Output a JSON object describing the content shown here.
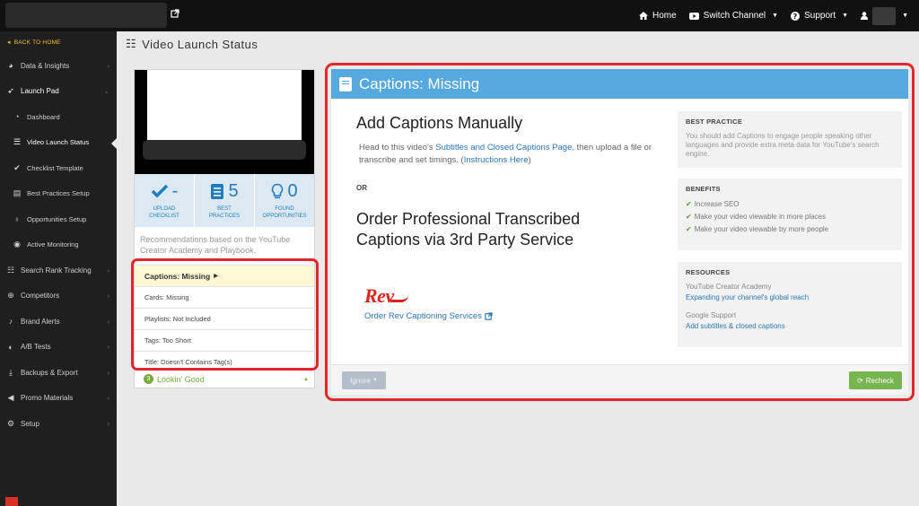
{
  "topbar": {
    "home": "Home",
    "switch_channel": "Switch Channel",
    "support": "Support"
  },
  "sidebar": {
    "back": "BACK TO HOME",
    "items": [
      {
        "label": "Data & Insights",
        "icon": "pie-chart-icon"
      },
      {
        "label": "Launch Pad",
        "icon": "rocket-icon"
      },
      {
        "label": "Dashboard",
        "icon": "dashboard-icon"
      },
      {
        "label": "Video Launch Status",
        "icon": "list-icon"
      },
      {
        "label": "Checklist Template",
        "icon": "check-icon"
      },
      {
        "label": "Best Practices Setup",
        "icon": "book-icon"
      },
      {
        "label": "Opportunities Setup",
        "icon": "lightbulb-icon"
      },
      {
        "label": "Active Monitoring",
        "icon": "eye-icon"
      },
      {
        "label": "Search Rank Tracking",
        "icon": "list-ol-icon"
      },
      {
        "label": "Competitors",
        "icon": "crosshair-icon"
      },
      {
        "label": "Brand Alerts",
        "icon": "bell-icon"
      },
      {
        "label": "A/B Tests",
        "icon": "contrast-icon"
      },
      {
        "label": "Backups & Export",
        "icon": "download-icon"
      },
      {
        "label": "Promo Materials",
        "icon": "megaphone-icon"
      },
      {
        "label": "Setup",
        "icon": "cogs-icon"
      }
    ]
  },
  "page": {
    "title": "Video Launch Status"
  },
  "stats": [
    {
      "value": "-",
      "label1": "UPLOAD",
      "label2": "CHECKLIST"
    },
    {
      "value": "5",
      "label1": "BEST",
      "label2": "PRACTICES"
    },
    {
      "value": "0",
      "label1": "FOUND",
      "label2": "OPPORTUNITIES"
    }
  ],
  "recommendations": "Recommendations based on the YouTube Creator Academy and Playbook.",
  "checklist": [
    "Captions: Missing",
    "Cards: Missing",
    "Playlists: Not Included",
    "Tags: Too Short",
    "Title: Doesn't Contains Tag(s)"
  ],
  "looking_good": {
    "count": "3",
    "label": "Lookin' Good"
  },
  "main": {
    "header": "Captions: Missing",
    "h_manual": "Add Captions Manually",
    "p_before": "Head to this video's ",
    "p_link1": "Subtitles and Closed Captions Page",
    "p_middle": ", then upload a file or transcribe and set timings. (",
    "p_link2": "Instructions Here",
    "p_after": ")",
    "or": "OR",
    "h_pro": "Order Professional Transcribed Captions via 3rd Party Service",
    "rev_logo": "Rev",
    "rev_link": "Order Rev Captioning Services",
    "best_practice_title": "BEST PRACTICE",
    "best_practice_text": "You should add Captions to engage people speaking other languages and provide extra meta data for YouTube's search engine.",
    "benefits_title": "BENEFITS",
    "benefits": [
      "Increase SEO",
      "Make your video viewable in more places",
      "Make your video viewable by more people"
    ],
    "resources_title": "RESOURCES",
    "resources": [
      {
        "source": "YouTube Creator Academy",
        "link": "Expanding your channel's global reach"
      },
      {
        "source": "Google Support",
        "link": "Add subtitles & closed captions"
      }
    ],
    "ignore": "Ignore",
    "recheck": "Recheck"
  }
}
